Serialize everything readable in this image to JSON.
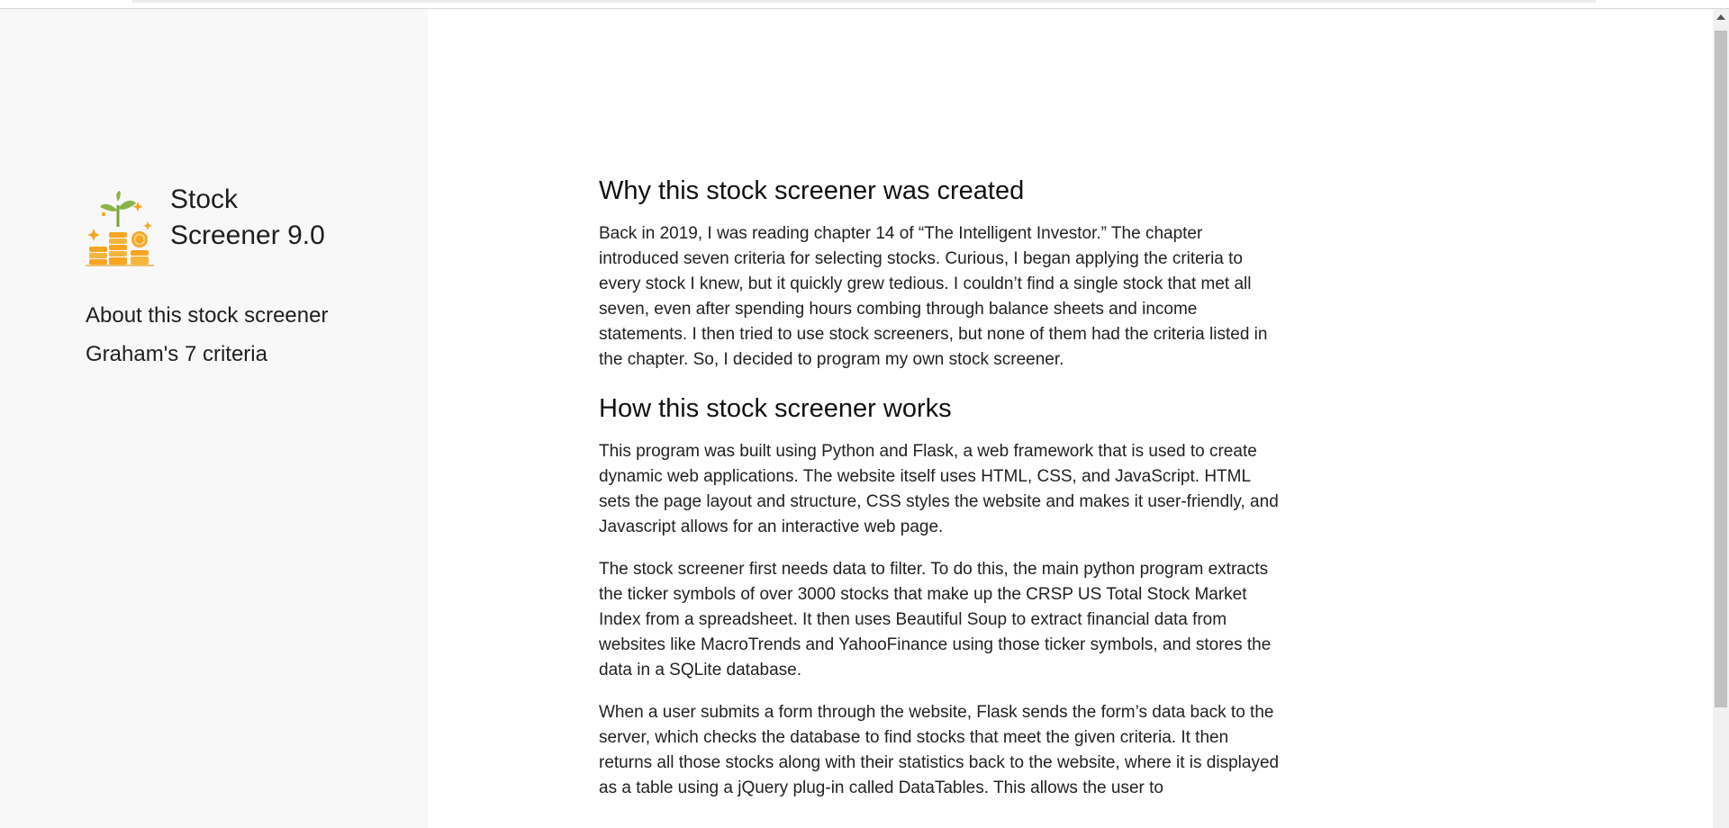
{
  "brand": {
    "title_line1": "Stock",
    "title_line2": "Screener 9.0",
    "logo_icon": "coins-plant-icon",
    "accent": "#f6a623",
    "leaf_color": "#8ab44a"
  },
  "nav": {
    "items": [
      {
        "label": "About this stock screener"
      },
      {
        "label": "Graham's 7 criteria"
      }
    ]
  },
  "main": {
    "section1": {
      "heading": "Why this stock screener was created",
      "paragraphs": [
        "Back in 2019, I was reading chapter 14 of “The Intelligent Investor.” The chapter introduced seven criteria for selecting stocks. Curious, I began applying the criteria to every stock I knew, but it quickly grew tedious. I couldn’t find a single stock that met all seven, even after spending hours combing through balance sheets and income statements. I then tried to use stock screeners, but none of them had the criteria listed in the chapter. So, I decided to program my own stock screener."
      ]
    },
    "section2": {
      "heading": "How this stock screener works",
      "paragraphs": [
        "This program was built using Python and Flask, a web framework that is used to create dynamic web applications. The website itself uses HTML, CSS, and JavaScript. HTML sets the page layout and structure, CSS styles the website and makes it user-friendly, and Javascript allows for an interactive web page.",
        "The stock screener first needs data to filter. To do this, the main python program extracts the ticker symbols of over 3000 stocks that make up the CRSP US Total Stock Market Index from a spreadsheet. It then uses Beautiful Soup to extract financial data from websites like MacroTrends and YahooFinance using those ticker symbols, and stores the data in a SQLite database.",
        "When a user submits a form through the website, Flask sends the form’s data back to the server, which checks the database to find stocks that meet the given criteria. It then returns all those stocks along with their statistics back to the website, where it is displayed as a table using a jQuery plug-in called DataTables. This allows the user to"
      ]
    }
  }
}
